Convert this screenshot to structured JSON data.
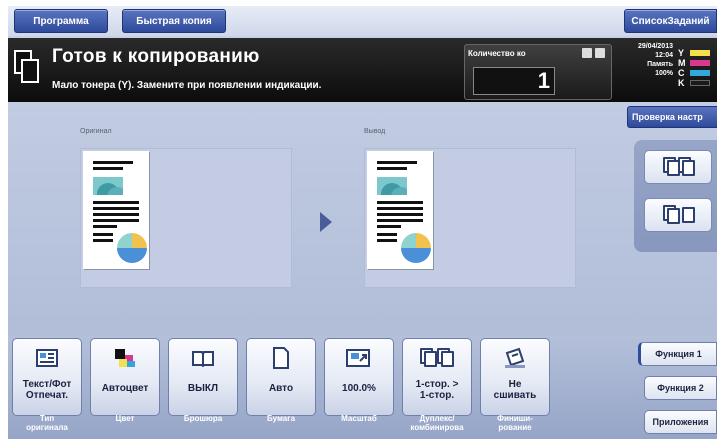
{
  "header": {
    "program_label": "Программа",
    "quick_copy_label": "Быстрая копия",
    "job_list_label": "СписокЗаданий"
  },
  "status": {
    "title": "Готов к копированию",
    "message": "Мало тонера (Y). Замените при появлении индикации.",
    "quantity_label": "Количество ко",
    "quantity_value": "1",
    "date": "29/04/2013",
    "time": "12:04",
    "memory_label": "Память",
    "memory_value": "100%",
    "toner": [
      {
        "letter": "Y",
        "color": "#f4e04a"
      },
      {
        "letter": "M",
        "color": "#d8398f"
      },
      {
        "letter": "C",
        "color": "#33a6dc"
      },
      {
        "letter": "K",
        "color": "#1a1a1a"
      }
    ]
  },
  "check_settings_label": "Проверка настр",
  "preview": {
    "original_label": "Оригинал",
    "output_label": "Вывод"
  },
  "functions": [
    {
      "text": "Текст/Фот\nОтпечат.",
      "label": "Тип\nоригинала",
      "icon": "document-type-icon"
    },
    {
      "text": "Автоцвет",
      "label": "Цвет",
      "icon": "color-icon"
    },
    {
      "text": "ВЫКЛ",
      "label": "Брошюра",
      "icon": "booklet-icon"
    },
    {
      "text": "Авто",
      "label": "Бумага",
      "icon": "paper-icon"
    },
    {
      "text": "100.0%",
      "label": "Масштаб",
      "icon": "zoom-icon"
    },
    {
      "text": "1-стор. >\n1-стор.",
      "label": "Дуплекс/\nкомбинирова",
      "icon": "duplex-icon"
    },
    {
      "text": "Не\nсшивать",
      "label": "Финиши-\nрование",
      "icon": "finishing-icon"
    }
  ],
  "tabs": {
    "function1": "Функция 1",
    "function2": "Функция 2",
    "applications": "Приложения"
  }
}
